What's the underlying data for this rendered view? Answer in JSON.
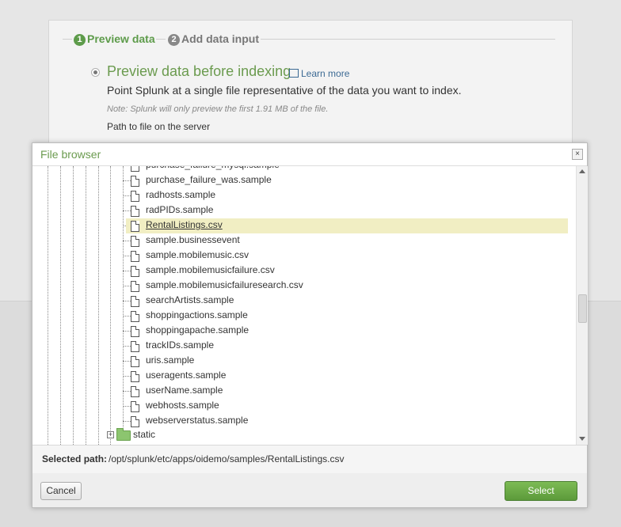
{
  "wizard": {
    "step1_num": "1",
    "step1_label": "Preview data",
    "step2_num": "2",
    "step2_label": "Add data input",
    "preview_title": "Preview data before indexing",
    "learn_more": "Learn more",
    "description": "Point Splunk at a single file representative of the data you want to index.",
    "note": "Note: Splunk will only preview the first 1.91 MB of the file.",
    "path_label": "Path to file on the server"
  },
  "dialog": {
    "title": "File browser",
    "close": "×",
    "files": [
      "purchase_failure_mysql.sample",
      "purchase_failure_was.sample",
      "radhosts.sample",
      "radPIDs.sample",
      "RentalListings.csv",
      "sample.businessevent",
      "sample.mobilemusic.csv",
      "sample.mobilemusicfailure.csv",
      "sample.mobilemusicfailuresearch.csv",
      "searchArtists.sample",
      "shoppingactions.sample",
      "shoppingapache.sample",
      "trackIDs.sample",
      "uris.sample",
      "useragents.sample",
      "userName.sample",
      "webhosts.sample",
      "webserverstatus.sample"
    ],
    "selected_index": 4,
    "folder": "static",
    "selected_path_label": "Selected path:",
    "selected_path": "/opt/splunk/etc/apps/oidemo/samples/RentalListings.csv",
    "cancel_label": "Cancel",
    "select_label": "Select"
  },
  "colors": {
    "accent_green": "#6b9b4f",
    "selection_highlight": "#f1eec3",
    "select_button": "#5c9a3a"
  }
}
